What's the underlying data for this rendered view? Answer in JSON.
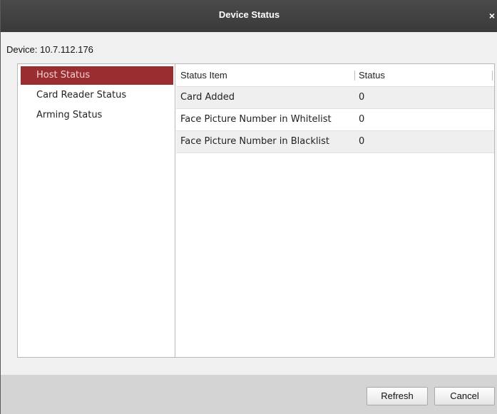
{
  "dialog": {
    "title": "Device Status",
    "close_glyph": "×"
  },
  "device_label": "Device: 10.7.112.176",
  "nav": {
    "items": [
      {
        "label": "Host Status",
        "selected": true
      },
      {
        "label": "Card Reader Status",
        "selected": false
      },
      {
        "label": "Arming Status",
        "selected": false
      }
    ]
  },
  "table": {
    "headers": [
      "Status Item",
      "Status"
    ],
    "rows": [
      {
        "item": "Card Added",
        "status": "0"
      },
      {
        "item": "Face Picture Number in Whitelist",
        "status": "0"
      },
      {
        "item": "Face Picture Number in Blacklist",
        "status": "0"
      }
    ]
  },
  "buttons": {
    "refresh": "Refresh",
    "cancel": "Cancel"
  },
  "colors": {
    "titlebar": "#3f3f3f",
    "selected_nav": "#9a2d2f",
    "footer": "#d4d4d4"
  }
}
